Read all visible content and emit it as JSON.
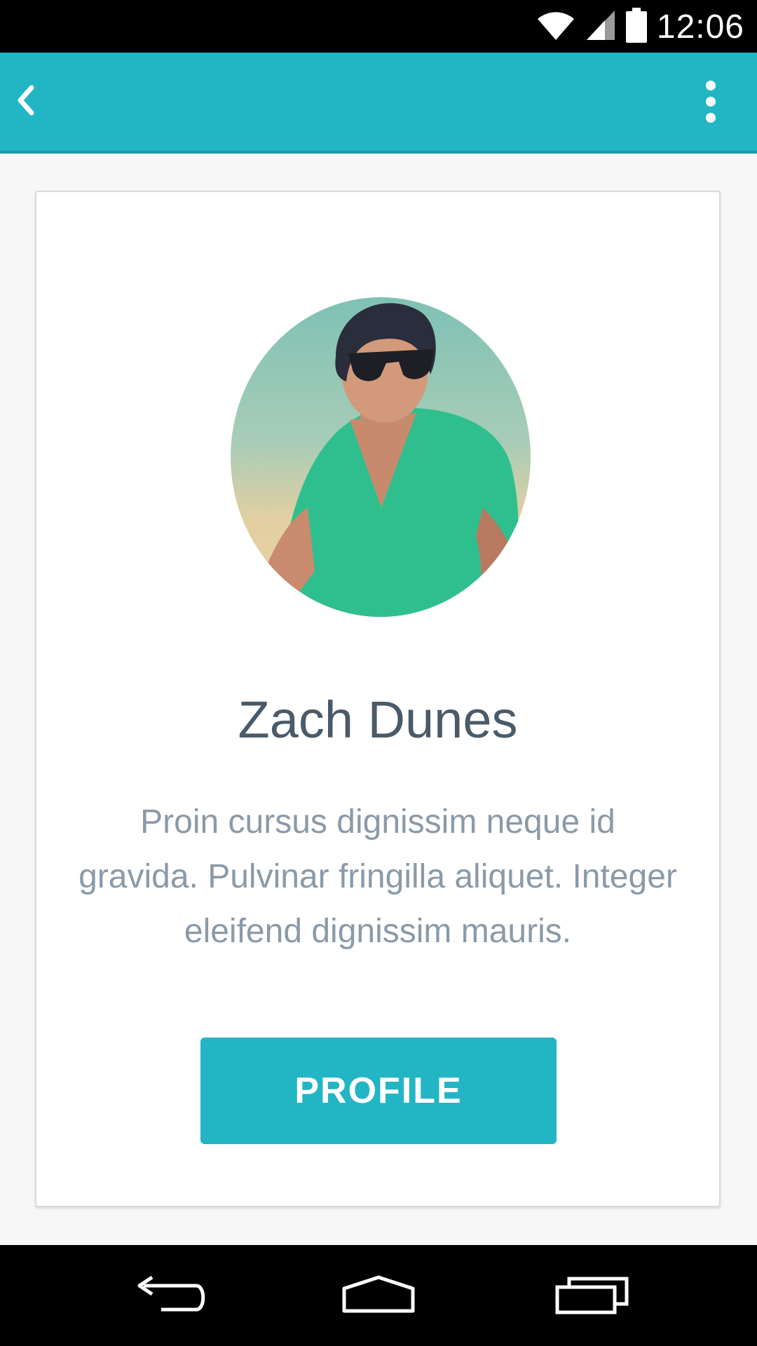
{
  "status_bar": {
    "time": "12:06",
    "icons": [
      "wifi-icon",
      "cell-signal-icon",
      "battery-icon"
    ]
  },
  "app_bar": {
    "back_icon": "chevron-left-icon",
    "menu_icon": "overflow-menu-icon",
    "color": "#22b5c4"
  },
  "card": {
    "avatar": "profile-photo",
    "name": "Zach Dunes",
    "bio": "Proin cursus dignissim neque id gravida. Pulvinar fringilla aliquet. Integer eleifend dignissim mauris.",
    "button_label": "PROFILE"
  },
  "nav_bar": {
    "icons": [
      "back-nav-icon",
      "home-nav-icon",
      "recents-nav-icon"
    ]
  },
  "colors": {
    "accent": "#22b5c4",
    "name_text": "#4a5a68",
    "bio_text": "#8a9aa8"
  }
}
